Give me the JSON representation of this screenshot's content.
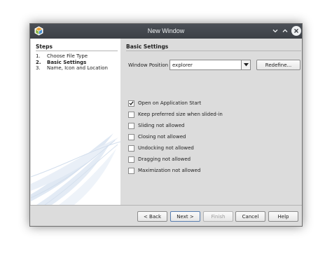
{
  "window": {
    "title": "New Window"
  },
  "steps": {
    "header": "Steps",
    "items": [
      {
        "num": "1.",
        "label": "Choose File Type",
        "active": false
      },
      {
        "num": "2.",
        "label": "Basic Settings",
        "active": true
      },
      {
        "num": "3.",
        "label": "Name, Icon and Location",
        "active": false
      }
    ]
  },
  "basic_settings": {
    "header": "Basic Settings",
    "window_position_label": "Window Position :",
    "window_position_value": "explorer",
    "redefine_label": "Redefine...",
    "options": [
      {
        "label": "Open on Application Start",
        "checked": true
      },
      {
        "label": "Keep preferred size when slided-in",
        "checked": false
      },
      {
        "label": "Sliding not allowed",
        "checked": false
      },
      {
        "label": "Closing not allowed",
        "checked": false
      },
      {
        "label": "Undocking not allowed",
        "checked": false
      },
      {
        "label": "Dragging not allowed",
        "checked": false
      },
      {
        "label": "Maximization not allowed",
        "checked": false
      }
    ]
  },
  "footer": {
    "back_label": "< Back",
    "next_label": "Next >",
    "finish_label": "Finish",
    "cancel_label": "Cancel",
    "help_label": "Help"
  }
}
